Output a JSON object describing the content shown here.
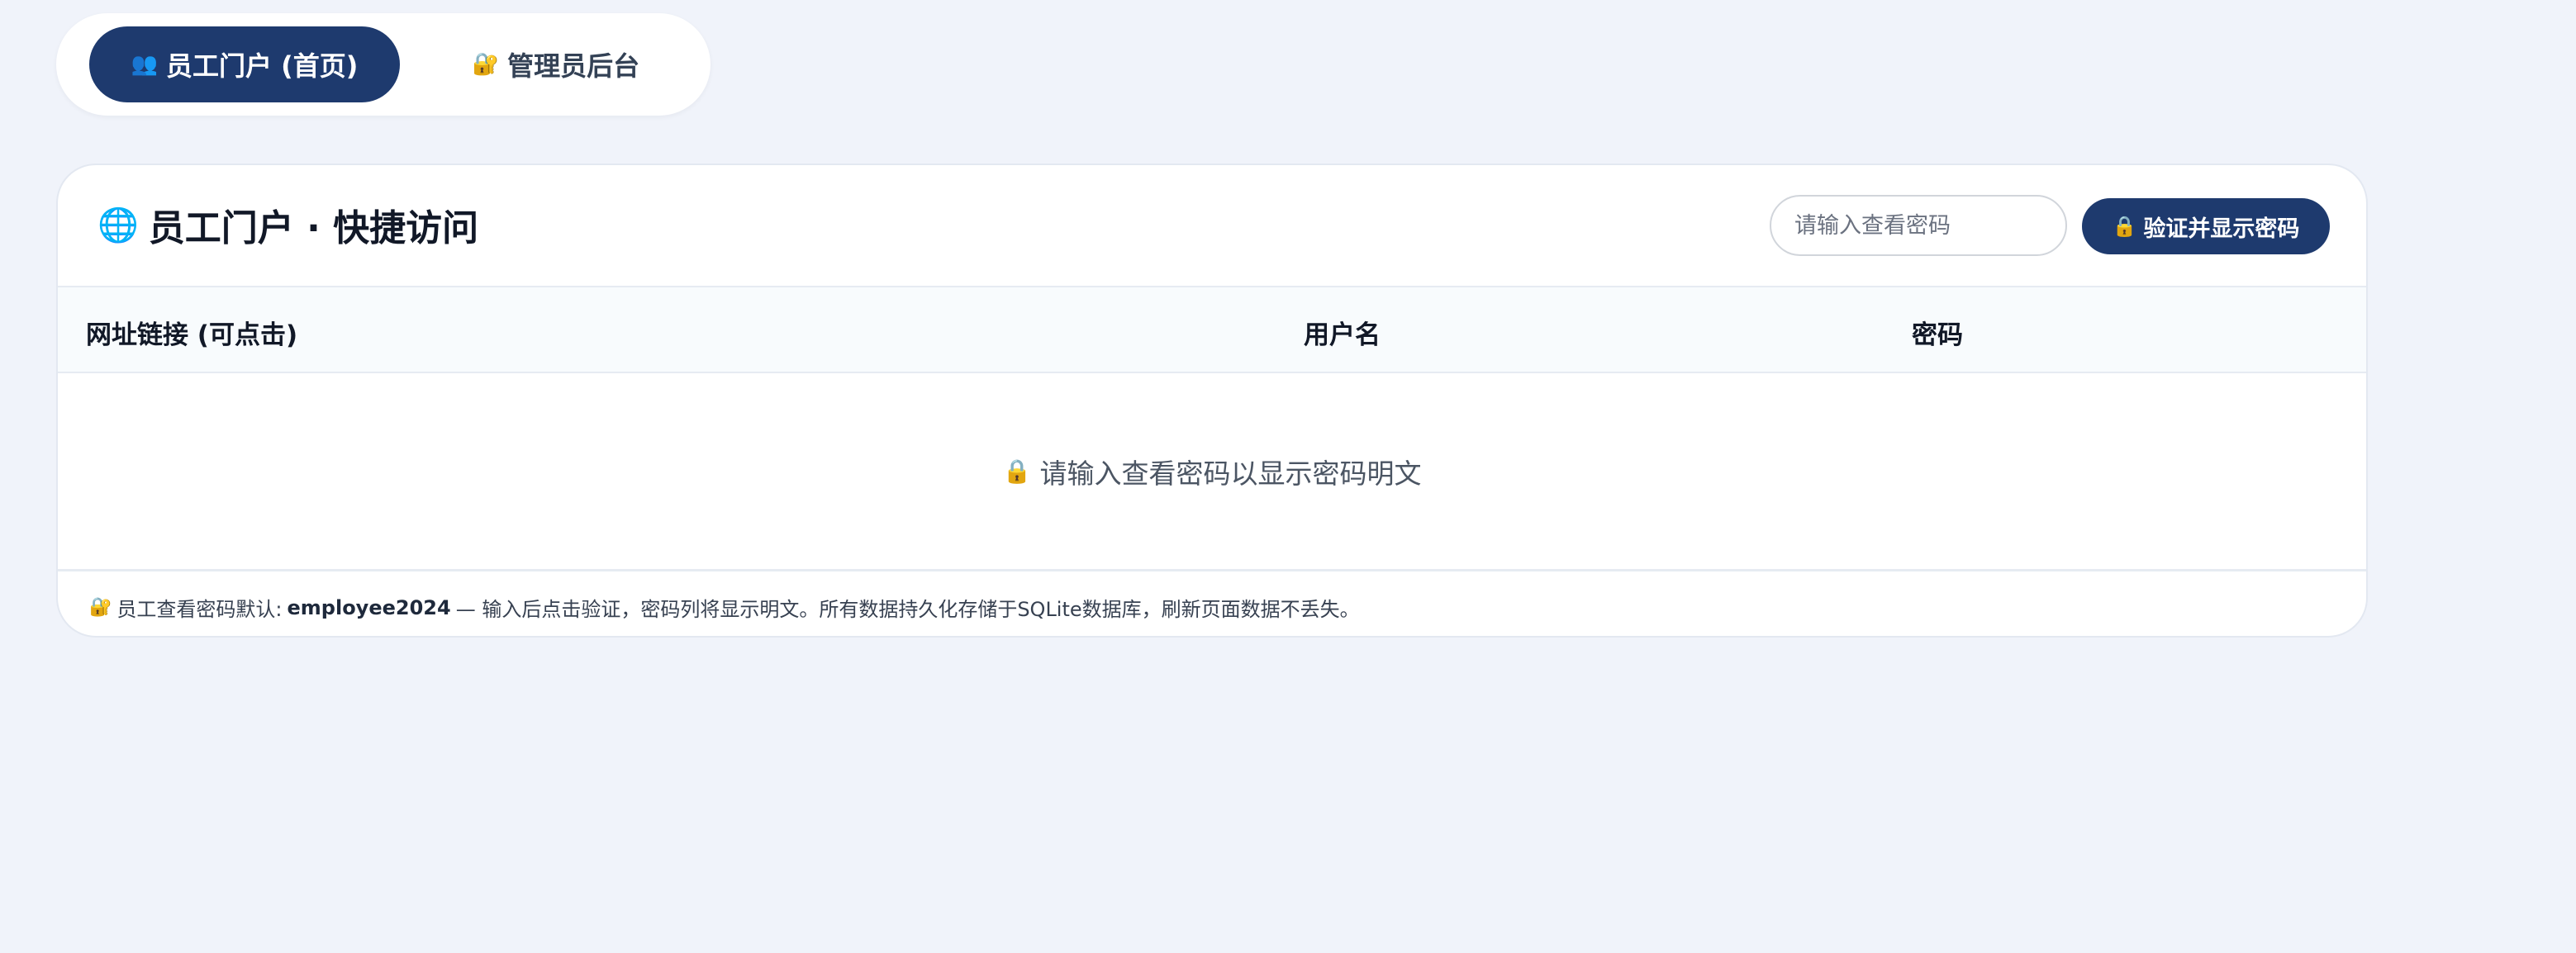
{
  "tabs": [
    {
      "icon": "users-icon",
      "glyph": "👥",
      "label": "员工门户 (首页)"
    },
    {
      "icon": "lock-key-icon",
      "glyph": "🔐",
      "label": "管理员后台"
    }
  ],
  "card": {
    "title_glyph": "🌐",
    "title": "员工门户 · 快捷访问",
    "password_placeholder": "请输入查看密码",
    "password_value": "",
    "verify_glyph": "🔒",
    "verify_label": "验证并显示密码"
  },
  "table": {
    "columns": [
      "网址链接 (可点击)",
      "用户名",
      "密码"
    ],
    "empty_glyph": "🔒",
    "empty_message": "请输入查看密码以显示密码明文"
  },
  "footer": {
    "glyph": "🔐",
    "prefix": "员工查看密码默认:",
    "default_password": "employee2024",
    "suffix": "— 输入后点击验证，密码列将显示明文。所有数据持久化存储于SQLite数据库，刷新页面数据不丢失。"
  },
  "colors": {
    "background": "#f0f3fa",
    "primary": "#1e3a6e",
    "card": "#ffffff"
  }
}
